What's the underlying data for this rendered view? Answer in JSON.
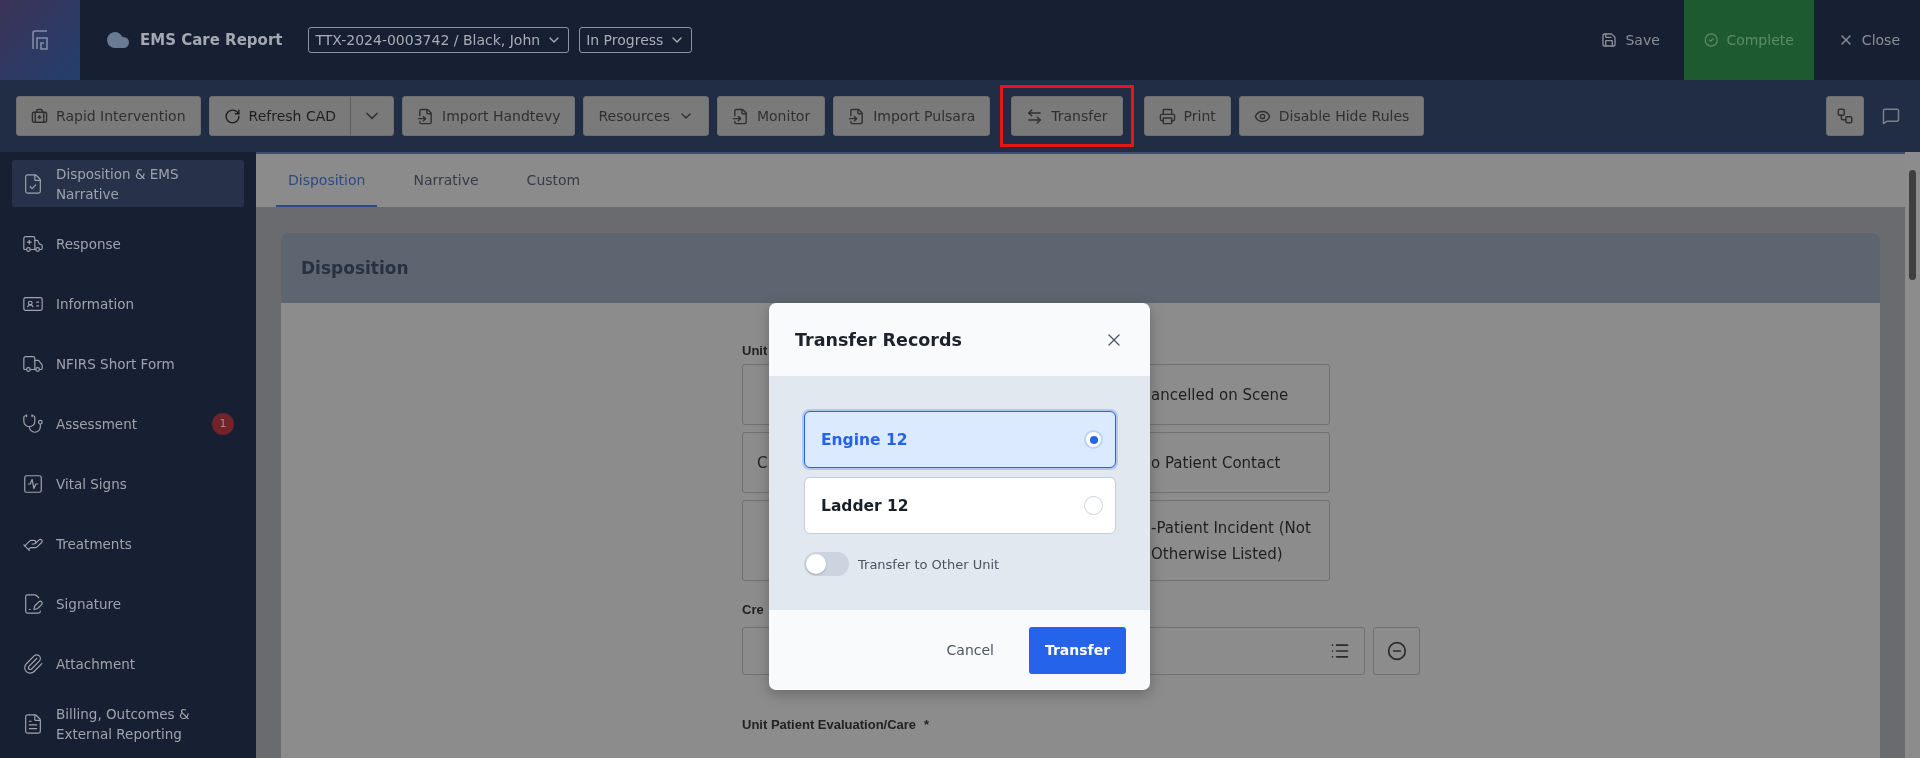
{
  "app": {
    "title": "EMS Care Report",
    "record": "TTX-2024-0003742 / Black, John",
    "status": "In Progress"
  },
  "header_actions": [
    {
      "kind": "save",
      "label": "Save"
    },
    {
      "kind": "complete",
      "label": "Complete"
    },
    {
      "kind": "close",
      "label": "Close"
    }
  ],
  "toolbar": [
    {
      "kind": "kit",
      "label": "Rapid Intervention",
      "highlighted": false
    },
    {
      "kind": "refresh",
      "label": "Refresh CAD",
      "highlighted": false
    },
    {
      "kind": "import",
      "label": "Import Handtevy",
      "highlighted": false
    },
    {
      "kind": "menu",
      "label": "Resources",
      "highlighted": false
    },
    {
      "kind": "import",
      "label": "Monitor",
      "highlighted": false
    },
    {
      "kind": "import",
      "label": "Import Pulsara",
      "highlighted": false
    },
    {
      "kind": "transfer",
      "label": "Transfer",
      "highlighted": true
    },
    {
      "kind": "print",
      "label": "Print",
      "highlighted": false
    },
    {
      "kind": "eye",
      "label": "Disable Hide Rules",
      "highlighted": false
    }
  ],
  "sidebar": {
    "items": [
      {
        "label": "Disposition & EMS Narrative",
        "selected": true
      },
      {
        "label": "Response",
        "selected": false
      },
      {
        "label": "Information",
        "selected": false
      },
      {
        "label": "NFIRS Short Form",
        "selected": false
      },
      {
        "label": "Assessment",
        "selected": false,
        "badge": "1"
      },
      {
        "label": "Vital Signs",
        "selected": false
      },
      {
        "label": "Treatments",
        "selected": false
      },
      {
        "label": "Signature",
        "selected": false
      },
      {
        "label": "Attachment",
        "selected": false
      },
      {
        "label": "Billing, Outcomes & External Reporting",
        "selected": false
      }
    ]
  },
  "tabs": [
    {
      "label": "Disposition",
      "selected": true
    },
    {
      "label": "Narrative",
      "selected": false
    },
    {
      "label": "Custom",
      "selected": false
    }
  ],
  "section": {
    "title": "Disposition",
    "unit_label": "Unit",
    "option_rows": [
      {
        "right": "ancelled on Scene"
      },
      {
        "left": "C",
        "right": "o Patient Contact"
      },
      {
        "right": "-Patient Incident (Not\nOtherwise Listed)"
      }
    ],
    "crew_label": "Cre",
    "evaluation_label": "Unit Patient Evaluation/Care",
    "evaluation_required": "*"
  },
  "modal": {
    "title": "Transfer Records",
    "units": [
      {
        "label": "Engine 12",
        "selected": true
      },
      {
        "label": "Ladder 12",
        "selected": false
      }
    ],
    "toggle": {
      "label": "Transfer to Other Unit",
      "on": false
    },
    "cancel": "Cancel",
    "confirm": "Transfer"
  }
}
